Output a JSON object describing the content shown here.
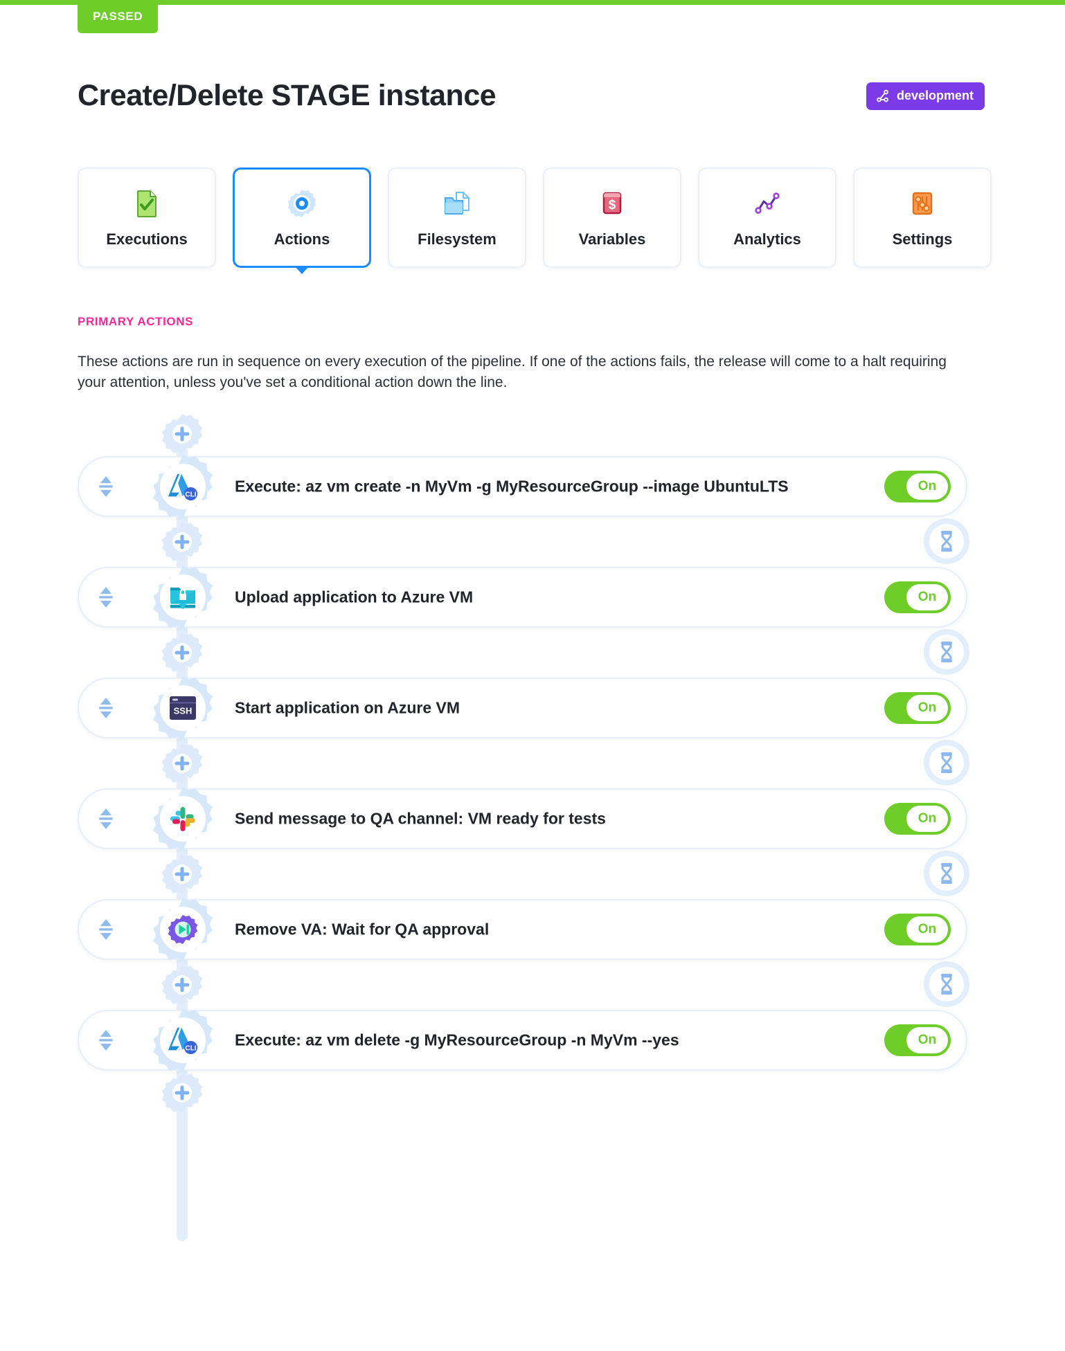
{
  "status": {
    "label": "PASSED",
    "color": "#6ECD29"
  },
  "header": {
    "title": "Create/Delete STAGE instance",
    "env_badge": {
      "label": "development",
      "icon": "sitemap-icon",
      "color": "#7C3BE8"
    }
  },
  "tabs": [
    {
      "label": "Executions",
      "icon": "document-check-icon",
      "active": false
    },
    {
      "label": "Actions",
      "icon": "gear-icon",
      "active": true
    },
    {
      "label": "Filesystem",
      "icon": "folder-files-icon",
      "active": false
    },
    {
      "label": "Variables",
      "icon": "dollar-card-icon",
      "active": false
    },
    {
      "label": "Analytics",
      "icon": "line-chart-icon",
      "active": false
    },
    {
      "label": "Settings",
      "icon": "sliders-icon",
      "active": false
    }
  ],
  "section": {
    "label": "PRIMARY ACTIONS",
    "label_color": "#F6289B",
    "description": "These actions are run in sequence on every execution of the pipeline. If one of the actions fails, the release will come to a halt requiring your attention, unless you've set a conditional action down the line."
  },
  "pipeline": {
    "add_action_icon": "gear-plus-icon",
    "wait_icon": "hourglass-icon",
    "drag_handle_icon": "drag-updown-icon",
    "toggle_on_label": "On",
    "toggle_on_color": "#6ECD29",
    "actions": [
      {
        "title": "Execute: az vm create -n MyVm -g MyResourceGroup --image UbuntuLTS",
        "icon": "azure-cli-icon",
        "toggle": "On"
      },
      {
        "title": "Upload application to Azure VM",
        "icon": "sftp-folder-lock-icon",
        "toggle": "On"
      },
      {
        "title": "Start application on Azure VM",
        "icon": "ssh-terminal-icon",
        "toggle": "On"
      },
      {
        "title": "Send message to QA channel: VM ready for tests",
        "icon": "slack-icon",
        "toggle": "On"
      },
      {
        "title": "Remove VA: Wait for QA approval",
        "icon": "gear-play-icon",
        "toggle": "On"
      },
      {
        "title": "Execute: az vm delete -g MyResourceGroup -n MyVm --yes",
        "icon": "azure-cli-icon",
        "toggle": "On"
      }
    ]
  }
}
